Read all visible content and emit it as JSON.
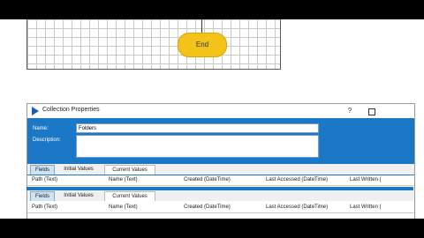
{
  "flow": {
    "end_label": "End"
  },
  "dialog": {
    "title": "Collection Properties",
    "help_button": "?",
    "name_label": "Name:",
    "name_value": "Folders",
    "description_label": "Description:",
    "description_value": "",
    "tabs": [
      "Fields",
      "Initial Values",
      "Current Values"
    ],
    "columns": [
      "Path  (Text)",
      "Name  (Text)",
      "Created  (DateTime)",
      "Last Accessed  (DateTime)",
      "Last Written  ("
    ]
  },
  "colors": {
    "accent": "#1a78c6",
    "end_node": "#f4c31a"
  }
}
